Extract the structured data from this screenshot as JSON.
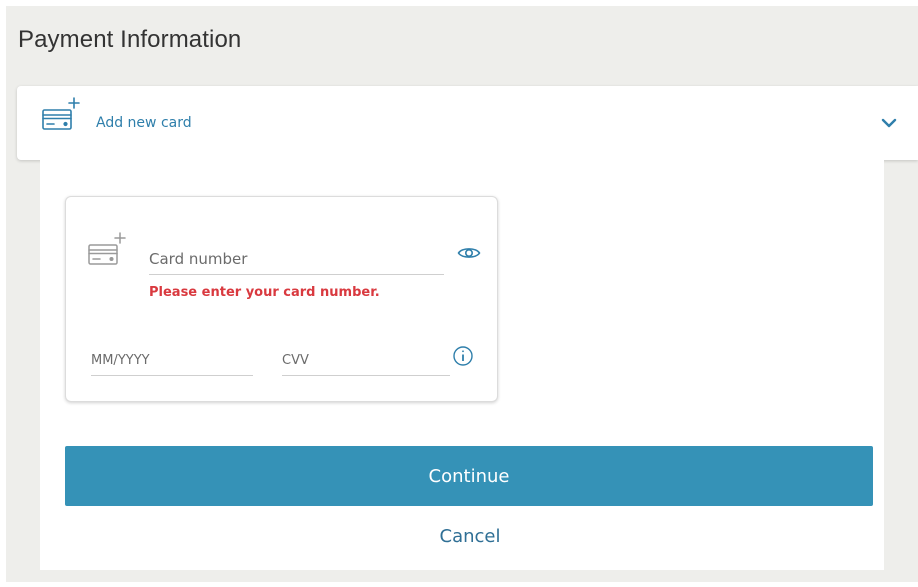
{
  "page": {
    "title": "Payment Information"
  },
  "card_selector": {
    "label": "Add new card",
    "icon": "add-card-icon",
    "dropdown_icon": "chevron-down-icon"
  },
  "card_form": {
    "card_number_placeholder": "Card number",
    "card_number_value": "",
    "card_number_error": "Please enter your card number.",
    "expiry_placeholder": "MM/YYYY",
    "expiry_value": "",
    "cvv_placeholder": "CVV",
    "cvv_value": "",
    "show_icon": "eye-icon",
    "cvv_help_icon": "info-icon"
  },
  "actions": {
    "continue_label": "Continue",
    "cancel_label": "Cancel"
  },
  "colors": {
    "accent": "#3592b7",
    "link": "#2f7fab",
    "error": "#d9393f",
    "background": "#eeeeeb"
  }
}
